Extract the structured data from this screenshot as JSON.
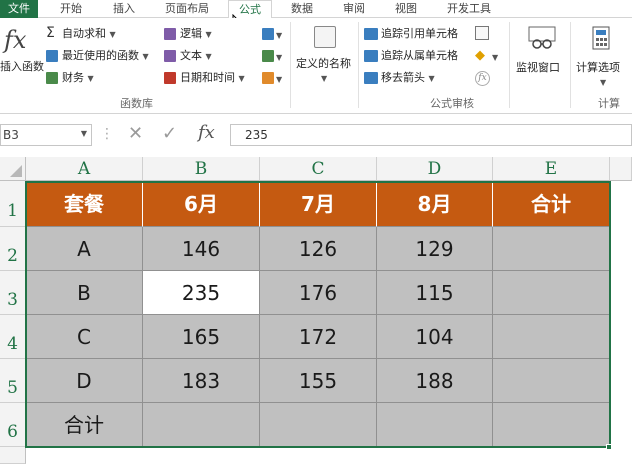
{
  "tabs": [
    "文件",
    "开始",
    "插入",
    "页面布局",
    "公式",
    "数据",
    "审阅",
    "视图",
    "开发工具"
  ],
  "ribbon": {
    "insert_function": "插入函数",
    "autosum": "自动求和",
    "recent": "最近使用的函数",
    "financial": "财务",
    "logical": "逻辑",
    "text": "文本",
    "datetime": "日期和时间",
    "group_library": "函数库",
    "define_name": "定义的名称",
    "trace_precedents": "追踪引用单元格",
    "trace_dependents": "追踪从属单元格",
    "remove_arrows": "移去箭头",
    "group_audit": "公式审核",
    "watch_window": "监视窗口",
    "calc_options": "计算选项",
    "group_calc": "计算"
  },
  "formula_bar": {
    "name_box": "B3",
    "fx": "fx",
    "value": "235"
  },
  "columns": [
    "A",
    "B",
    "C",
    "D",
    "E"
  ],
  "rows": [
    "1",
    "2",
    "3",
    "4",
    "5",
    "6"
  ],
  "table": {
    "header": [
      "套餐",
      "6月",
      "7月",
      "8月",
      "合计"
    ],
    "body": [
      [
        "A",
        "146",
        "126",
        "129",
        ""
      ],
      [
        "B",
        "235",
        "176",
        "115",
        ""
      ],
      [
        "C",
        "165",
        "172",
        "104",
        ""
      ],
      [
        "D",
        "183",
        "155",
        "188",
        ""
      ],
      [
        "合计",
        "",
        "",
        "",
        ""
      ]
    ]
  },
  "colors": {
    "header_fill": "#c55a11",
    "body_fill": "#c0c0c0",
    "accent": "#217346"
  }
}
